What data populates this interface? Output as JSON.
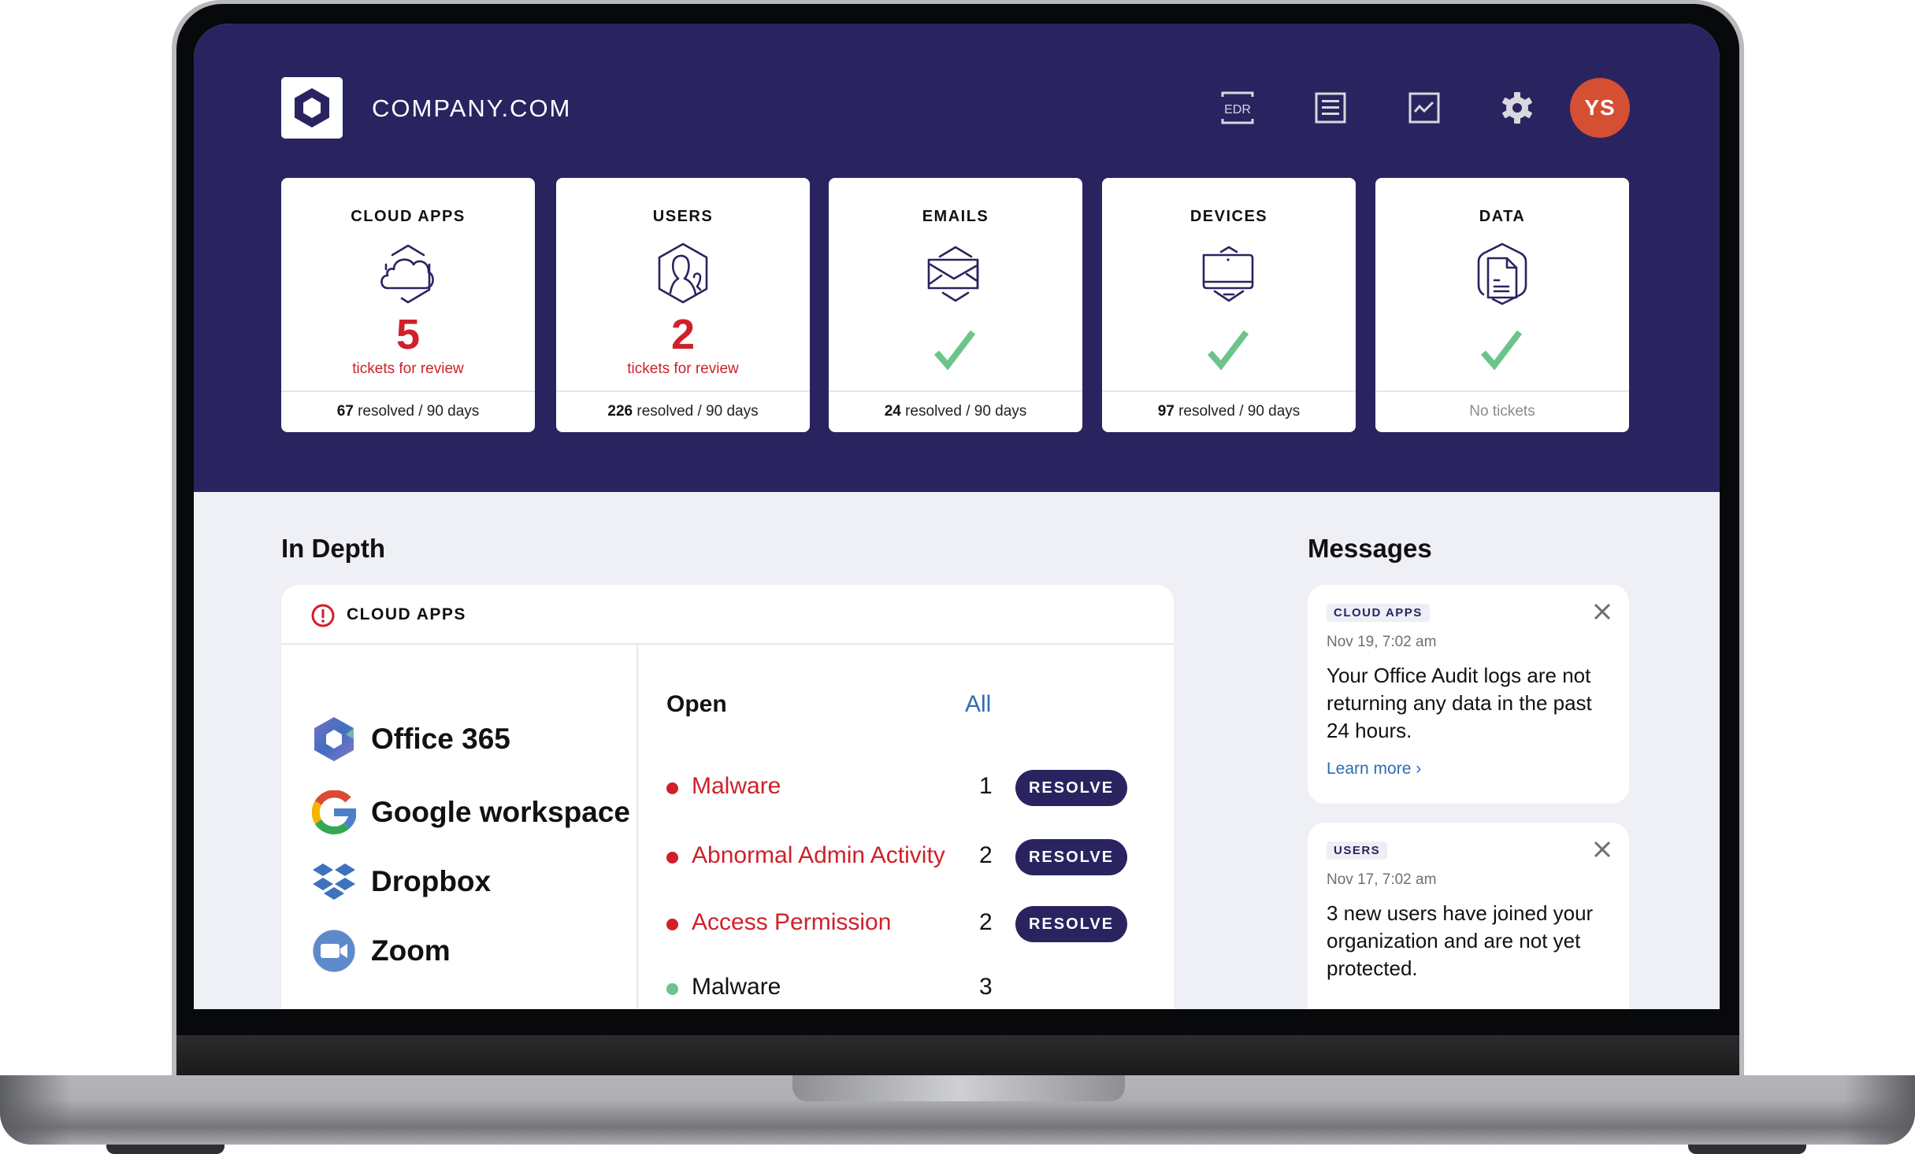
{
  "header": {
    "brand": "COMPANY.COM",
    "icons": [
      {
        "name": "edr-icon",
        "label": "EDR"
      },
      {
        "name": "list-icon"
      },
      {
        "name": "chart-icon"
      },
      {
        "name": "gear-icon"
      }
    ],
    "avatar_initials": "YS",
    "avatar_color": "#d54f32"
  },
  "stat_cards": [
    {
      "title": "CLOUD APPS",
      "icon": "cloud-icon",
      "status": "tickets",
      "count": "5",
      "sub": "tickets for review",
      "resolved": "67",
      "foot_suffix": " resolved / 90 days"
    },
    {
      "title": "USERS",
      "icon": "users-icon",
      "status": "tickets",
      "count": "2",
      "sub": "tickets for review",
      "resolved": "226",
      "foot_suffix": " resolved / 90 days"
    },
    {
      "title": "EMAILS",
      "icon": "email-icon",
      "status": "ok",
      "resolved": "24",
      "foot_suffix": " resolved / 90 days"
    },
    {
      "title": "DEVICES",
      "icon": "laptop-icon",
      "status": "ok",
      "resolved": "97",
      "foot_suffix": " resolved / 90 days"
    },
    {
      "title": "DATA",
      "icon": "document-icon",
      "status": "ok",
      "foot_text": "No tickets"
    }
  ],
  "in_depth": {
    "title": "In Depth",
    "card_label": "CLOUD APPS",
    "apps": [
      "Office 365",
      "Google workspace",
      "Dropbox",
      "Zoom"
    ],
    "open_label": "Open",
    "all_label": "All",
    "issues": [
      {
        "label": "Malware",
        "count": "1",
        "severity": "critical",
        "action": "RESOLVE"
      },
      {
        "label": "Abnormal Admin Activity",
        "count": "2",
        "severity": "critical",
        "action": "RESOLVE"
      },
      {
        "label": "Access Permission",
        "count": "2",
        "severity": "critical",
        "action": "RESOLVE"
      },
      {
        "label": "Malware",
        "count": "3",
        "severity": "ok"
      }
    ]
  },
  "messages": {
    "title": "Messages",
    "items": [
      {
        "tag": "CLOUD APPS",
        "date": "Nov 19, 7:02 am",
        "text": "Your Office Audit logs are not returning any data in the past 24 hours.",
        "link": "Learn more ›"
      },
      {
        "tag": "USERS",
        "date": "Nov 17, 7:02 am",
        "text": "3 new users have joined your organization and are not yet protected."
      }
    ]
  },
  "colors": {
    "navy": "#292460",
    "alert_red": "#d0202a",
    "ok_green": "#6cc48a",
    "link_blue": "#2f6cb3"
  }
}
